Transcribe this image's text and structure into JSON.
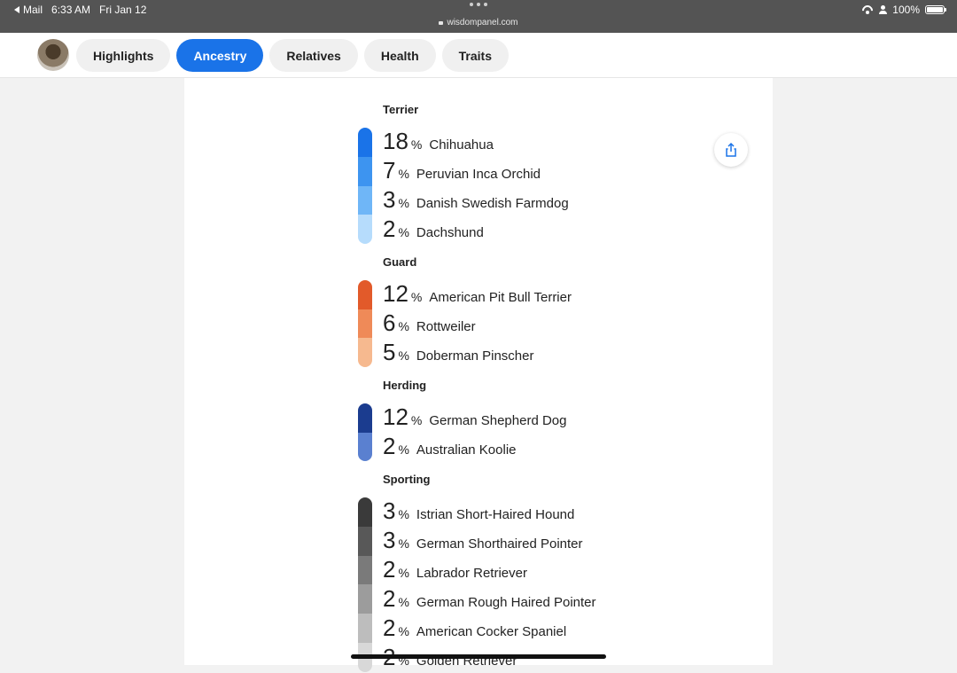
{
  "status_bar": {
    "back_app": "Mail",
    "time": "6:33 AM",
    "date": "Fri Jan 12",
    "url": "wisdompanel.com",
    "battery": "100%"
  },
  "nav": {
    "tabs": [
      {
        "label": "Highlights",
        "active": false
      },
      {
        "label": "Ancestry",
        "active": true
      },
      {
        "label": "Relatives",
        "active": false
      },
      {
        "label": "Health",
        "active": false
      },
      {
        "label": "Traits",
        "active": false
      }
    ]
  },
  "ancestry": {
    "groups": [
      {
        "title": "Terrier",
        "colors": [
          "#1a73e8",
          "#3d94f0",
          "#6fb6f7",
          "#b6dcfc"
        ],
        "breeds": [
          {
            "percent": "18",
            "symbol": "%",
            "name": "Chihuahua"
          },
          {
            "percent": "7",
            "symbol": "%",
            "name": "Peruvian Inca Orchid"
          },
          {
            "percent": "3",
            "symbol": "%",
            "name": "Danish Swedish Farmdog"
          },
          {
            "percent": "2",
            "symbol": "%",
            "name": "Dachshund"
          }
        ]
      },
      {
        "title": "Guard",
        "colors": [
          "#e25a2a",
          "#ef8a58",
          "#f6b98f"
        ],
        "breeds": [
          {
            "percent": "12",
            "symbol": "%",
            "name": "American Pit Bull Terrier"
          },
          {
            "percent": "6",
            "symbol": "%",
            "name": "Rottweiler"
          },
          {
            "percent": "5",
            "symbol": "%",
            "name": "Doberman Pinscher"
          }
        ]
      },
      {
        "title": "Herding",
        "colors": [
          "#1b3c8f",
          "#5a80d0"
        ],
        "breeds": [
          {
            "percent": "12",
            "symbol": "%",
            "name": "German Shepherd Dog"
          },
          {
            "percent": "2",
            "symbol": "%",
            "name": "Australian Koolie"
          }
        ]
      },
      {
        "title": "Sporting",
        "colors": [
          "#3a3a3a",
          "#585858",
          "#7a7a7a",
          "#9c9c9c",
          "#bdbdbd",
          "#d8d8d8"
        ],
        "breeds": [
          {
            "percent": "3",
            "symbol": "%",
            "name": "Istrian Short-Haired Hound"
          },
          {
            "percent": "3",
            "symbol": "%",
            "name": "German Shorthaired Pointer"
          },
          {
            "percent": "2",
            "symbol": "%",
            "name": "Labrador Retriever"
          },
          {
            "percent": "2",
            "symbol": "%",
            "name": "German Rough Haired Pointer"
          },
          {
            "percent": "2",
            "symbol": "%",
            "name": "American Cocker Spaniel"
          },
          {
            "percent": "2",
            "symbol": "%",
            "name": "Golden Retriever"
          }
        ]
      }
    ]
  },
  "icons": {
    "share": "share-icon",
    "avatar": "dog-avatar"
  }
}
